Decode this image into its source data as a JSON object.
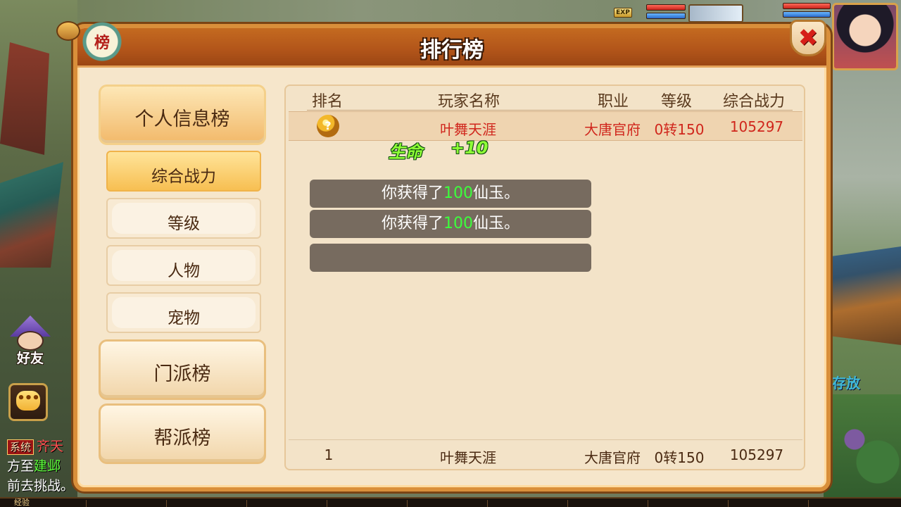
{
  "window": {
    "title": "排行榜",
    "badge_char": "榜",
    "close_symbol": "✖"
  },
  "hud": {
    "exp_tag": "EXP",
    "friend_label": "好友",
    "chat_icon": "•••",
    "right_hint": "存放",
    "exp_bar_label": "经验"
  },
  "system_chat": {
    "tag": "系统",
    "line1_red": "齐天",
    "line2_prefix": "方至",
    "line2_green": "建邺",
    "line3": "前去挑战。"
  },
  "nav": {
    "main_items": [
      {
        "label": "个人信息榜",
        "active": true
      },
      {
        "label": "门派榜",
        "active": false
      },
      {
        "label": "帮派榜",
        "active": false
      }
    ],
    "sub_items": [
      {
        "label": "综合战力",
        "active": true
      },
      {
        "label": "等级",
        "active": false
      },
      {
        "label": "人物",
        "active": false
      },
      {
        "label": "宠物",
        "active": false
      }
    ]
  },
  "table": {
    "headers": [
      "排名",
      "玩家名称",
      "职业",
      "等级",
      "综合战力"
    ],
    "rows": [
      {
        "rank_icon": "gold-medal-icon",
        "rank_symbol": "?",
        "name": "叶舞天涯",
        "class": "大唐官府",
        "level": "0转150",
        "power": "105297"
      }
    ],
    "self_row": {
      "rank": "1",
      "name": "叶舞天涯",
      "class": "大唐官府",
      "level": "0转150",
      "power": "105297"
    }
  },
  "floating": {
    "stat": "生命",
    "value": "+10"
  },
  "toasts": [
    {
      "prefix": "你获得了",
      "amount": "100",
      "suffix": "仙玉。"
    },
    {
      "prefix": "你获得了",
      "amount": "100",
      "suffix": "仙玉。"
    },
    {
      "prefix": "",
      "amount": "",
      "suffix": ""
    }
  ],
  "colors": {
    "panel_border": "#d98f3a",
    "title_bar": "#b3561a",
    "highlight_text": "#d0261c",
    "toast_green": "#3cff3c",
    "float_green": "#8eff36"
  }
}
